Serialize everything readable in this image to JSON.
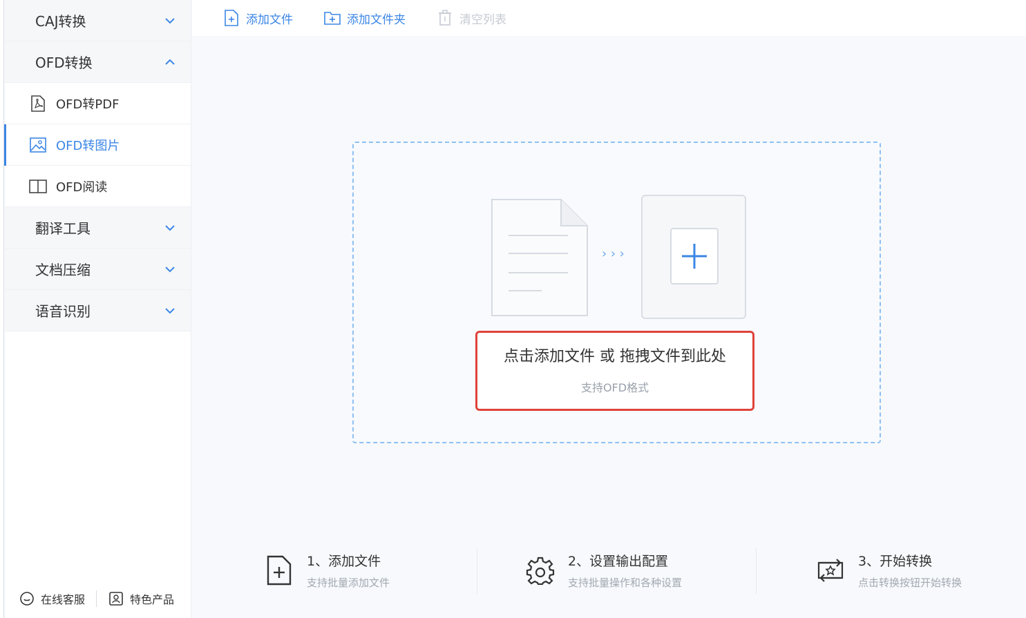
{
  "sidebar": {
    "groups": [
      {
        "label": "CAJ转换",
        "expanded": false
      },
      {
        "label": "OFD转换",
        "expanded": true
      },
      {
        "label": "翻译工具",
        "expanded": false
      },
      {
        "label": "文档压缩",
        "expanded": false
      },
      {
        "label": "语音识别",
        "expanded": false
      }
    ],
    "ofd_items": [
      {
        "label": "OFD转PDF",
        "icon": "pdf-file-icon"
      },
      {
        "label": "OFD转图片",
        "icon": "image-file-icon",
        "active": true
      },
      {
        "label": "OFD阅读",
        "icon": "book-open-icon"
      }
    ],
    "footer": {
      "service_label": "在线客服",
      "products_label": "特色产品"
    }
  },
  "toolbar": {
    "add_file_label": "添加文件",
    "add_folder_label": "添加文件夹",
    "clear_list_label": "清空列表"
  },
  "dropzone": {
    "main_text": "点击添加文件 或 拖拽文件到此处",
    "sub_text": "支持OFD格式",
    "arrows": "›››"
  },
  "steps": [
    {
      "title": "1、添加文件",
      "desc": "支持批量添加文件",
      "icon": "add-file-icon"
    },
    {
      "title": "2、设置输出配置",
      "desc": "支持批量操作和各种设置",
      "icon": "gear-icon"
    },
    {
      "title": "3、开始转换",
      "desc": "点击转换按钮开始转换",
      "icon": "convert-icon"
    }
  ],
  "colors": {
    "accent": "#3b86e6",
    "highlight_border": "#e0423a",
    "dashed_border": "#8ec0f2"
  }
}
